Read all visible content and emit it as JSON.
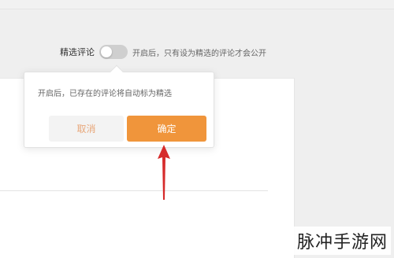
{
  "toolbar": {
    "featured_label": "精选评论",
    "toggle_hint": "开启后，只有设为精选的评论才会公开"
  },
  "popover": {
    "message": "开启后，已存在的评论将自动标为精选",
    "cancel_label": "取消",
    "confirm_label": "确定"
  },
  "toggle": {
    "state": "off"
  },
  "watermark": "脉冲手游网",
  "colors": {
    "confirm": "#f0953b",
    "cancel_text": "#e8a77a",
    "arrow": "#d62b2b",
    "toggle_off": "#cfcfcf"
  },
  "icons": {
    "annotation": "red-arrow-up-icon"
  }
}
